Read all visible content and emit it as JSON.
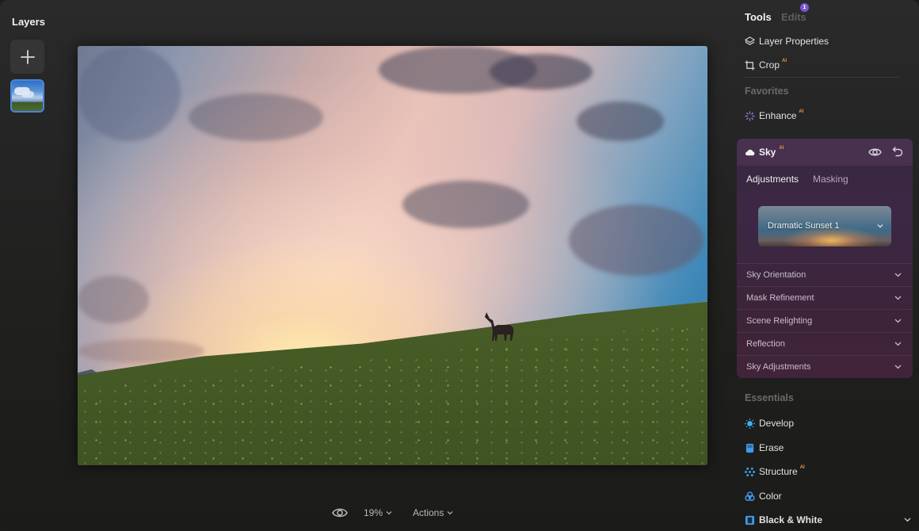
{
  "layers_panel": {
    "title": "Layers",
    "add_button_icon": "plus-icon",
    "layers": [
      {
        "name": "sky-photo-layer",
        "selected": true
      }
    ]
  },
  "canvas": {
    "image_description": "Sunset sky over grassy hillside with a lone elk silhouette"
  },
  "bottom_toolbar": {
    "view_icon": "eye-icon",
    "zoom_level": "19%",
    "actions_label": "Actions"
  },
  "right_panel": {
    "tabs": [
      {
        "label": "Tools",
        "active": true
      },
      {
        "label": "Edits",
        "active": false,
        "badge": "1"
      }
    ],
    "top_items": [
      {
        "label": "Layer Properties",
        "icon": "layers-icon",
        "ai": false
      },
      {
        "label": "Crop",
        "icon": "crop-icon",
        "ai": true
      }
    ],
    "ai_tag": "AI",
    "favorites": {
      "title": "Favorites",
      "items": [
        {
          "label": "Enhance",
          "icon": "sparkle-icon",
          "ai": true
        }
      ]
    },
    "sky_card": {
      "title": "Sky",
      "icon": "cloud-icon",
      "ai": true,
      "subtabs": [
        {
          "label": "Adjustments",
          "active": true
        },
        {
          "label": "Masking",
          "active": false
        }
      ],
      "preset": "Dramatic Sunset 1",
      "sections": [
        "Sky Orientation",
        "Mask Refinement",
        "Scene Relighting",
        "Reflection",
        "Sky Adjustments"
      ]
    },
    "essentials": {
      "title": "Essentials",
      "items": [
        {
          "label": "Develop",
          "icon": "sun-icon",
          "ai": false
        },
        {
          "label": "Erase",
          "icon": "eraser-icon",
          "ai": false
        },
        {
          "label": "Structure",
          "icon": "structure-icon",
          "ai": true
        },
        {
          "label": "Color",
          "icon": "color-circles-icon",
          "ai": false
        },
        {
          "label": "Black & White",
          "icon": "black-white-icon",
          "ai": false
        }
      ]
    },
    "colors": {
      "accent_purple": "#7a55d6",
      "ai_orange": "#e49a4a",
      "layer_selected_border": "#4a84d8",
      "essentials_icon_blue": "#3d9be9"
    }
  }
}
